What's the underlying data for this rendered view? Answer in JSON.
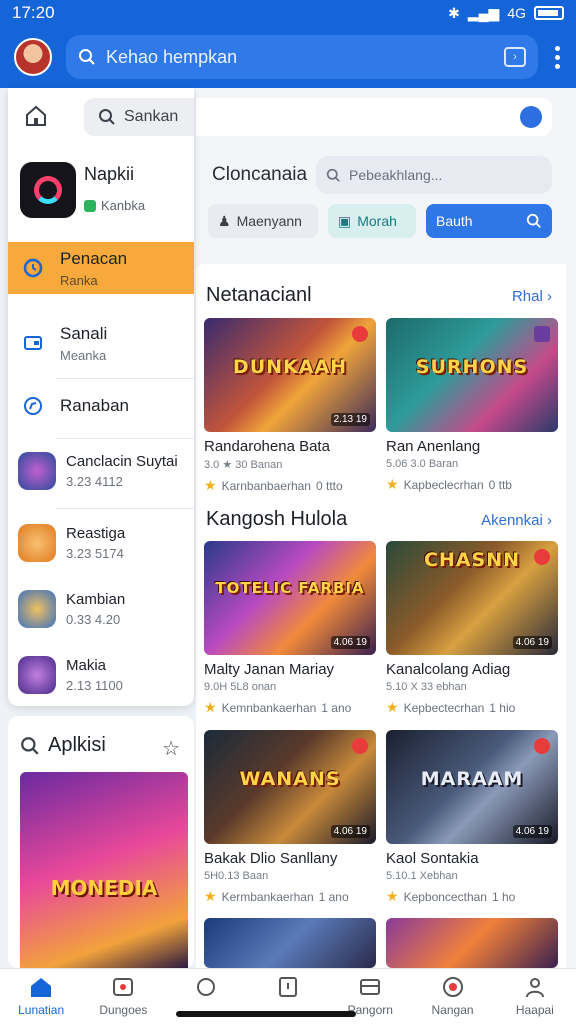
{
  "status": {
    "time": "17:20",
    "network": "4G"
  },
  "header": {
    "search_text": "Kehao hempkan"
  },
  "drawer": {
    "search_label": "Sankan",
    "app": {
      "name": "Napkii",
      "subtitle": "Kanbka"
    },
    "items": [
      {
        "label": "Penacan",
        "sub": "Ranka",
        "icon": "clock-icon"
      },
      {
        "label": "Sanali",
        "sub": "Meanka",
        "icon": "wallet-icon"
      },
      {
        "label": "Ranaban",
        "sub": "",
        "icon": "compass-icon"
      },
      {
        "label": "Canclacin Suytai",
        "sub": "3.23 4112",
        "icon": "game-icon"
      },
      {
        "label": "Reastiga",
        "sub": "3.23 5174",
        "icon": "game-icon"
      },
      {
        "label": "Kambian",
        "sub": "0.33 4.20",
        "icon": "game-icon"
      },
      {
        "label": "Makia",
        "sub": "2.13 1100",
        "icon": "game-icon"
      }
    ]
  },
  "aplikasi_card": {
    "title": "Aplkisi",
    "poster_title": "MONEDIA"
  },
  "main": {
    "title": "Cloncanaia",
    "find_placeholder": "Pebeakhlang...",
    "chips": {
      "c1": "Maenyann",
      "c2": "Morah",
      "c3": "Bauth"
    },
    "sections": [
      {
        "title": "Netanacianl",
        "more": "Rhal",
        "cards": [
          {
            "title_art": "DUNKAAH",
            "name": "Randarohena Bata",
            "meta": "3.0 ★ 30 Banan",
            "dev": "Karnbanbaerhan",
            "rating": "0 ttto",
            "badge": "2.13 19"
          },
          {
            "title_art": "SURHONS",
            "name": "Ran Anenlang",
            "meta": "5.06 3.0 Baran",
            "dev": "Kapbeclecrhan",
            "rating": "0 ttb",
            "badge": ""
          }
        ]
      },
      {
        "title": "Kangosh Hulola",
        "more": "Akennkai",
        "cards": [
          {
            "title_art": "TOTELIC FARBIA",
            "name": "Malty Janan Mariay",
            "meta": "9.0H 5L8 onan",
            "dev": "Kemnbankaerhan",
            "rating": "1 ano",
            "badge": "4.06 19"
          },
          {
            "title_art": "CHASNN",
            "name": "Kanalcolang Adiag",
            "meta": "5.10 X 33 ebhan",
            "dev": "Kepbectecrhan",
            "rating": "1 hio",
            "badge": "4.06 19"
          }
        ]
      },
      {
        "title": "",
        "more": "",
        "cards": [
          {
            "title_art": "WANANS",
            "name": "Bakak Dlio Sanllany",
            "meta": "5H0.13 Baan",
            "dev": "Kermbankaerhan",
            "rating": "1 ano",
            "badge": "4.06 19"
          },
          {
            "title_art": "MARAAM",
            "name": "Kaol Sontakia",
            "meta": "5.10.1 Xebhan",
            "dev": "Kepboncecthan",
            "rating": "1 ho",
            "badge": "4.06 19"
          }
        ]
      }
    ]
  },
  "bottom_nav": [
    {
      "label": "Lunatian",
      "icon": "home-icon"
    },
    {
      "label": "Dungoes",
      "icon": "gamepad-icon"
    },
    {
      "label": "",
      "icon": "sync-icon"
    },
    {
      "label": "",
      "icon": "tablet-icon"
    },
    {
      "label": "Pangorn",
      "icon": "tray-icon"
    },
    {
      "label": "Nangan",
      "icon": "record-icon"
    },
    {
      "label": "Haapai",
      "icon": "profile-icon"
    }
  ],
  "colors": {
    "primary": "#1565d8",
    "accent": "#f8a93c",
    "surface": "#ffffff"
  }
}
